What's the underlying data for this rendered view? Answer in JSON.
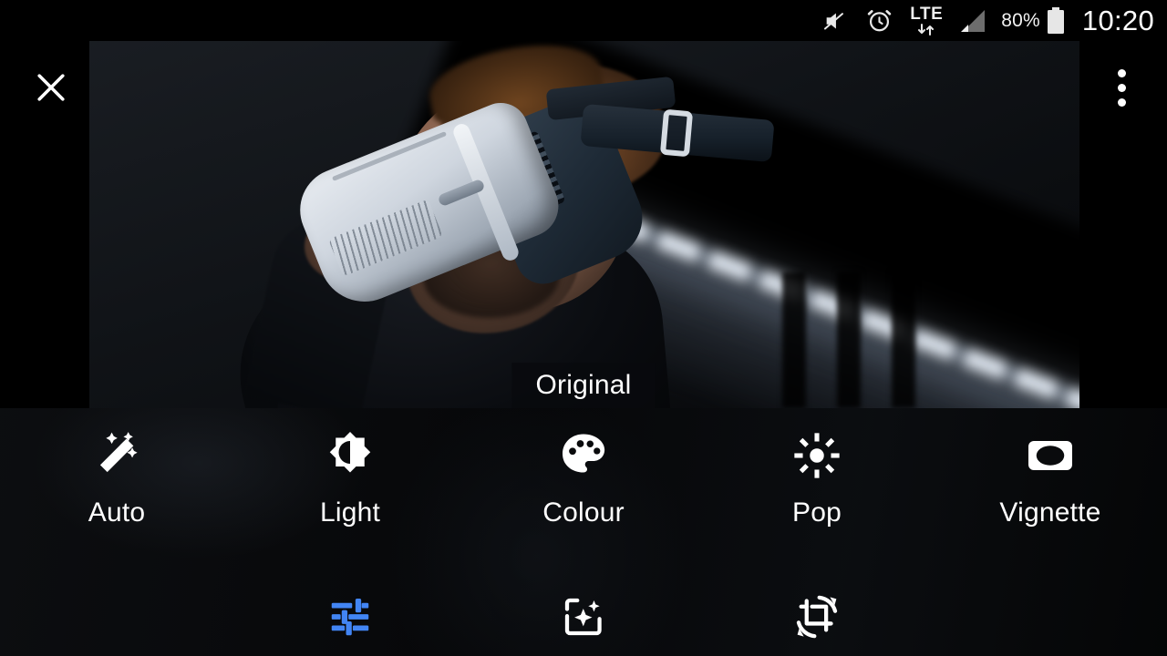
{
  "status_bar": {
    "time": "10:20",
    "battery_percent": "80%",
    "network_type": "LTE",
    "icons": [
      "mute-icon",
      "alarm-icon",
      "lte-icon",
      "signal-icon",
      "battery-icon"
    ]
  },
  "photo_editor": {
    "close_label": "close-icon",
    "overflow_label": "overflow-menu-icon",
    "preview_chip": "Original"
  },
  "adjustments": [
    {
      "id": "auto",
      "label": "Auto",
      "icon": "magic-wand-icon",
      "selected": false
    },
    {
      "id": "light",
      "label": "Light",
      "icon": "brightness-icon",
      "selected": false
    },
    {
      "id": "colour",
      "label": "Colour",
      "icon": "palette-icon",
      "selected": false
    },
    {
      "id": "pop",
      "label": "Pop",
      "icon": "sun-burst-icon",
      "selected": false
    },
    {
      "id": "vignette",
      "label": "Vignette",
      "icon": "vignette-icon",
      "selected": false
    }
  ],
  "tools": [
    {
      "id": "tune",
      "icon": "tune-sliders-icon",
      "active": true
    },
    {
      "id": "filters",
      "icon": "filter-sparkle-icon",
      "active": false
    },
    {
      "id": "crop",
      "icon": "crop-rotate-icon",
      "active": false
    }
  ],
  "colors": {
    "accent": "#4285F4",
    "icon_white": "#FFFFFF",
    "panel_bg": "#0A0B0D",
    "status_bg": "#000000"
  }
}
